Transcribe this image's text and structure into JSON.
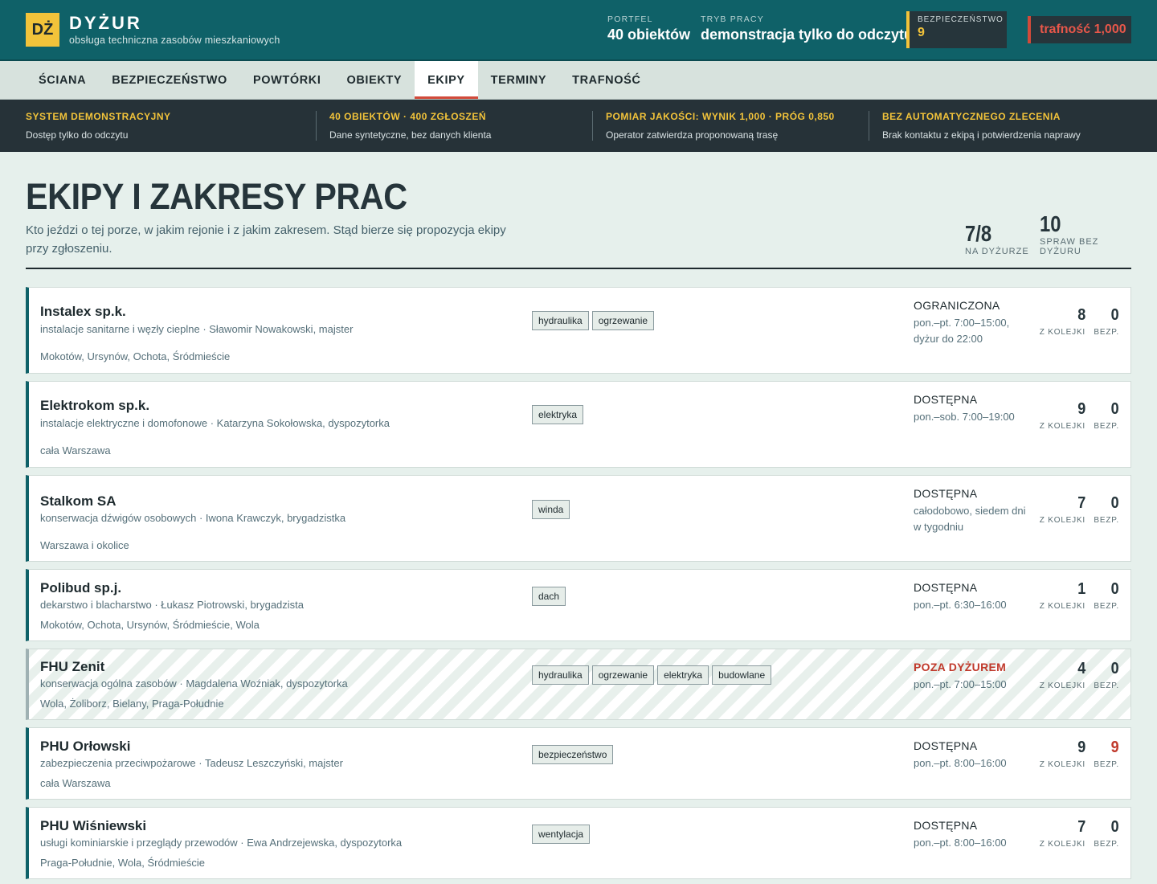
{
  "header": {
    "logo": "DŻ",
    "brand": "DYŻUR",
    "subtitle": "obsługa techniczna zasobów mieszkaniowych",
    "portfolio_label": "PORTFEL",
    "portfolio_value": "40 obiektów",
    "mode_label": "TRYB PRACY",
    "mode_value": "demonstracja tylko do odczytu",
    "safety_label": "BEZPIECZEŃSTWO",
    "safety_value": "9",
    "accuracy": "trafność 1,000"
  },
  "tabs": [
    "ŚCIANA",
    "BEZPIECZEŃSTWO",
    "POWTÓRKI",
    "OBIEKTY",
    "EKIPY",
    "TERMINY",
    "TRAFNOŚĆ"
  ],
  "info": [
    {
      "title": "SYSTEM DEMONSTRACYJNY",
      "text": "Dostęp tylko do odczytu"
    },
    {
      "title": "40 OBIEKTÓW · 400 ZGŁOSZEŃ",
      "text": "Dane syntetyczne, bez danych klienta"
    },
    {
      "title": "POMIAR JAKOŚCI: WYNIK 1,000 · PRÓG 0,850",
      "text": "Operator zatwierdza proponowaną trasę"
    },
    {
      "title": "BEZ AUTOMATYCZNEGO ZLECENIA",
      "text": "Brak kontaktu z ekipą i potwierdzenia naprawy"
    }
  ],
  "page": {
    "title": "EKIPY I ZAKRESY PRAC",
    "description": "Kto jeździ o tej porze, w jakim rejonie i z jakim zakresem. Stąd bierze się propozycja ekipy przy zgłoszeniu.",
    "kpi_onduty_value": "7/8",
    "kpi_onduty_label": "NA DYŻURZE",
    "kpi_uncovered_value": "10",
    "kpi_uncovered_label": "SPRAW BEZ DYŻURU"
  },
  "metric_labels": {
    "queue": "Z KOLEJKI",
    "safety": "BEZP."
  },
  "crews": [
    {
      "name": "Instalex sp.k.",
      "desc": "instalacje sanitarne i węzły cieplne · Sławomir Nowakowski, majster",
      "area": "Mokotów, Ursynów, Ochota, Śródmieście",
      "tags": [
        "hydraulika",
        "ogrzewanie"
      ],
      "status": "OGRANICZONA",
      "hours": "pon.–pt. 7:00–15:00, dyżur do 22:00",
      "queue": "8",
      "safety": "0"
    },
    {
      "name": "Elektrokom sp.k.",
      "desc": "instalacje elektryczne i domofonowe · Katarzyna Sokołowska, dyspozytorka",
      "area": "cała Warszawa",
      "tags": [
        "elektryka"
      ],
      "status": "DOSTĘPNA",
      "hours": "pon.–sob. 7:00–19:00",
      "queue": "9",
      "safety": "0"
    },
    {
      "name": "Stalkom SA",
      "desc": "konserwacja dźwigów osobowych · Iwona Krawczyk, brygadzistka",
      "area": "Warszawa i okolice",
      "tags": [
        "winda"
      ],
      "status": "DOSTĘPNA",
      "hours": "całodobowo, siedem dni w tygodniu",
      "queue": "7",
      "safety": "0"
    },
    {
      "name": "Polibud sp.j.",
      "desc": "dekarstwo i blacharstwo · Łukasz Piotrowski, brygadzista",
      "area": "Mokotów, Ochota, Ursynów, Śródmieście, Wola",
      "tags": [
        "dach"
      ],
      "status": "DOSTĘPNA",
      "hours": "pon.–pt. 6:30–16:00",
      "queue": "1",
      "safety": "0"
    },
    {
      "name": "FHU Zenit",
      "desc": "konserwacja ogólna zasobów · Magdalena Woźniak, dyspozytorka",
      "area": "Wola, Żoliborz, Bielany, Praga-Południe",
      "tags": [
        "hydraulika",
        "ogrzewanie",
        "elektryka",
        "budowlane"
      ],
      "status": "POZA DYŻUREM",
      "hours": "pon.–pt. 7:00–15:00",
      "queue": "4",
      "safety": "0"
    },
    {
      "name": "PHU Orłowski",
      "desc": "zabezpieczenia przeciwpożarowe · Tadeusz Leszczyński, majster",
      "area": "cała Warszawa",
      "tags": [
        "bezpieczeństwo"
      ],
      "status": "DOSTĘPNA",
      "hours": "pon.–pt. 8:00–16:00",
      "queue": "9",
      "safety": "9"
    },
    {
      "name": "PHU Wiśniewski",
      "desc": "usługi kominiarskie i przeglądy przewodów · Ewa Andrzejewska, dyspozytorka",
      "area": "Praga-Południe, Wola, Śródmieście",
      "tags": [
        "wentylacja"
      ],
      "status": "DOSTĘPNA",
      "hours": "pon.–pt. 8:00–16:00",
      "queue": "7",
      "safety": "0"
    }
  ]
}
